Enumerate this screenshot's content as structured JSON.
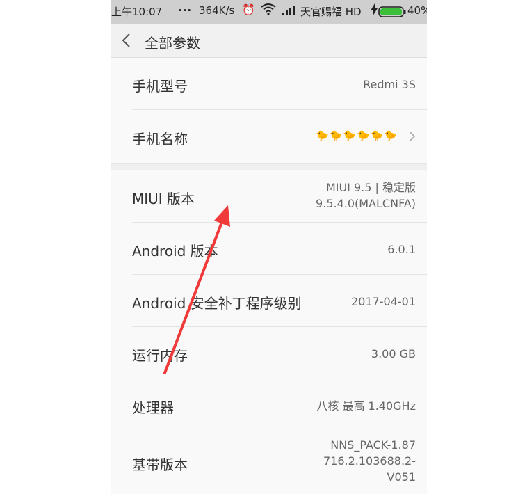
{
  "status_bar": {
    "time": "上午10:07",
    "dots": "...",
    "net_speed": "364K/s",
    "carrier": "天官赐福 HD",
    "battery_pct": "40%",
    "battery_level": 0.4,
    "icons": [
      "alarm-icon",
      "wifi-icon",
      "signal-icon",
      "charging-bolt-icon",
      "battery-icon"
    ]
  },
  "header": {
    "title": "全部参数",
    "back_icon": "chevron-left-icon"
  },
  "specs": {
    "model": {
      "label": "手机型号",
      "value": "Redmi 3S"
    },
    "device_name": {
      "label": "手机名称",
      "value": "🐤🐤🐤🐤🐤🐤"
    },
    "miui": {
      "label": "MIUI 版本",
      "value_line1": "MIUI 9.5 | 稳定版",
      "value_line2": "9.5.4.0(MALCNFA)"
    },
    "android": {
      "label": "Android 版本",
      "value": "6.0.1"
    },
    "security_patch": {
      "label": "Android 安全补丁程序级别",
      "value": "2017-04-01"
    },
    "ram": {
      "label": "运行内存",
      "value": "3.00 GB"
    },
    "cpu": {
      "label": "处理器",
      "value": "八核 最高 1.40GHz"
    },
    "baseband": {
      "label": "基带版本",
      "value_line1": "NNS_PACK-1.87",
      "value_line2": "716.2.103688.2-",
      "value_line3": "V051"
    }
  },
  "annotation": {
    "arrow_color": "#f03a3a"
  }
}
